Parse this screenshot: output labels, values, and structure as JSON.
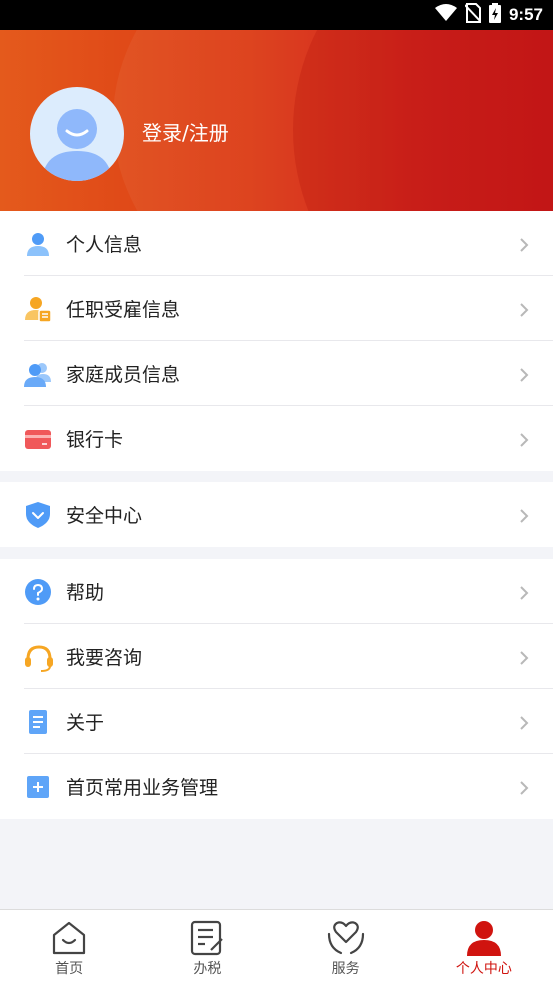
{
  "status_bar": {
    "time": "9:57"
  },
  "header": {
    "login_label": "登录/注册"
  },
  "groups": [
    {
      "items": [
        {
          "label": "个人信息",
          "icon": "person-icon"
        },
        {
          "label": "任职受雇信息",
          "icon": "employee-icon"
        },
        {
          "label": "家庭成员信息",
          "icon": "family-icon"
        },
        {
          "label": "银行卡",
          "icon": "bank-card-icon"
        }
      ]
    },
    {
      "items": [
        {
          "label": "安全中心",
          "icon": "shield-icon"
        }
      ]
    },
    {
      "items": [
        {
          "label": "帮助",
          "icon": "help-icon"
        },
        {
          "label": "我要咨询",
          "icon": "headset-icon"
        },
        {
          "label": "关于",
          "icon": "document-icon"
        },
        {
          "label": "首页常用业务管理",
          "icon": "plus-square-icon"
        }
      ]
    }
  ],
  "tabbar": {
    "tabs": [
      {
        "label": "首页",
        "icon": "home-icon",
        "active": false
      },
      {
        "label": "办税",
        "icon": "tax-form-icon",
        "active": false
      },
      {
        "label": "服务",
        "icon": "heart-hands-icon",
        "active": false
      },
      {
        "label": "个人中心",
        "icon": "profile-icon",
        "active": true
      }
    ]
  },
  "colors": {
    "brand_red": "#d0140f",
    "header_orange": "#e45a1c",
    "icon_blue": "#4f9bf7",
    "icon_orange": "#f6a623",
    "card_red": "#f0585a"
  }
}
